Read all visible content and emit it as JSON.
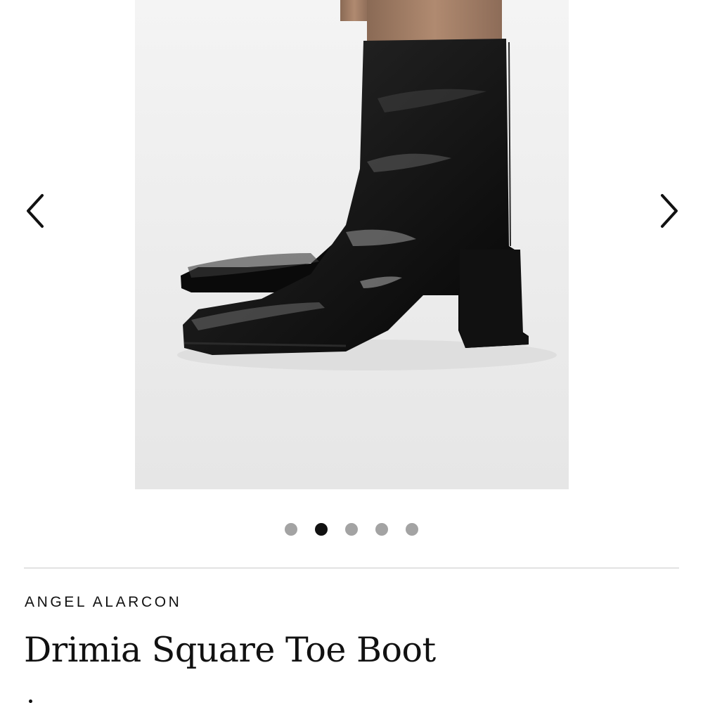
{
  "gallery": {
    "image": {
      "subject": "black patent leather square toe ankle boots with block heel",
      "background_color": "#eeeeee"
    },
    "prev_icon": "chevron-left-icon",
    "next_icon": "chevron-right-icon",
    "total_images": 5,
    "active_index": 1
  },
  "product": {
    "brand": "ANGEL ALARCON",
    "title": "Drimia Square Toe Boot"
  },
  "colors": {
    "text": "#111111",
    "dot_inactive": "#a3a3a3",
    "dot_active": "#111111",
    "divider": "#e2e2e2"
  }
}
